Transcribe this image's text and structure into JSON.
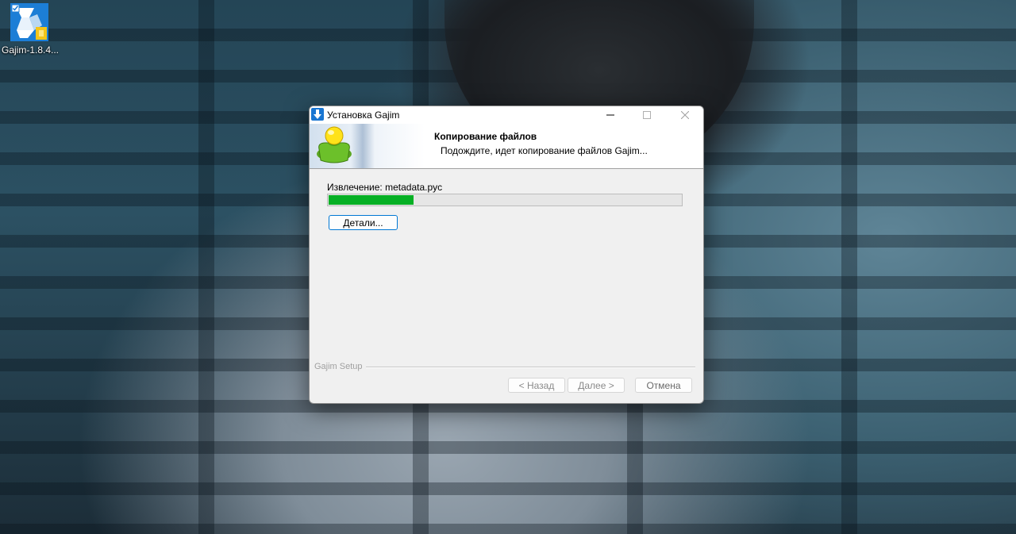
{
  "desktop": {
    "icon_label": "Gajim-1.8.4..."
  },
  "window": {
    "title": "Установка Gajim"
  },
  "header": {
    "title": "Копирование файлов",
    "subtitle": "Подождите, идет копирование файлов Gajim..."
  },
  "progress": {
    "status": "Извлечение: metadata.pyc",
    "fraction": 0.24,
    "fill_color": "#06b025"
  },
  "buttons": {
    "details": "Детали...",
    "back": "< Назад",
    "next": "Далее >",
    "cancel": "Отмена"
  },
  "footer": {
    "brand": "Gajim Setup"
  }
}
